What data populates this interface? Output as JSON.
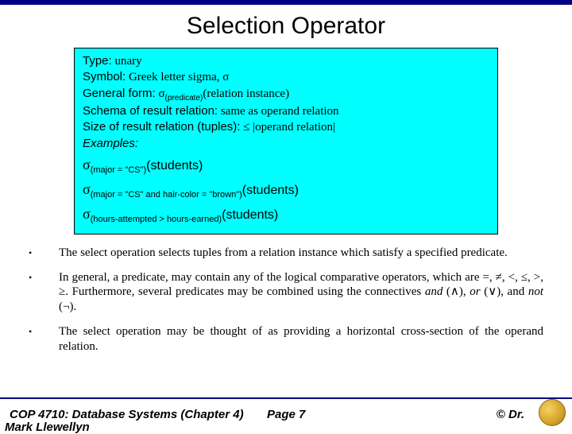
{
  "title": "Selection Operator",
  "info": {
    "type_label": "Type:",
    "type_value": "unary",
    "symbol_label": "Symbol:",
    "symbol_value": "Greek letter sigma, σ",
    "general_label": "General form:",
    "general_value_sigma": "σ",
    "general_value_sub": "(predicate)",
    "general_value_rest": "(relation instance)",
    "schema_label": "Schema of result relation:",
    "schema_value": "same as operand relation",
    "size_label": "Size of result relation (tuples):",
    "size_value": "≤ |operand relation|",
    "examples_label": "Examples:",
    "ex1_sub": "(major = \"CS\")",
    "ex1_rel": "(students)",
    "ex2_sub": "(major = \"CS\" and hair-color = \"brown\")",
    "ex2_rel": "(students)",
    "ex3_sub": "(hours-attempted > hours-earned)",
    "ex3_rel": "(students)"
  },
  "bullets": [
    "The select operation selects tuples from a relation instance which satisfy a specified predicate.",
    "In general, a predicate, may contain any of the logical comparative operators, which are =, ≠, <, ≤, >, ≥. Furthermore, several predicates may be combined using the connectives and (∧), or (∨), and not (¬).",
    "The select operation may be thought of as providing a horizontal cross-section of the operand relation."
  ],
  "bullets_rich": {
    "b2_pre": "In general, a predicate, may contain any of the logical comparative operators, which are =, ≠, <, ≤, >, ≥. Furthermore, several predicates may be combined using the connectives ",
    "b2_and": "and",
    "b2_and_sym": " (∧), ",
    "b2_or": "or",
    "b2_or_sym": " (∨), and ",
    "b2_not": "not",
    "b2_not_sym": " (¬)."
  },
  "footer": {
    "course": "COP 4710: Database Systems  (Chapter 4)",
    "page": "Page 7",
    "author": "© Dr.",
    "author_cut": "Mark Llewellyn"
  }
}
